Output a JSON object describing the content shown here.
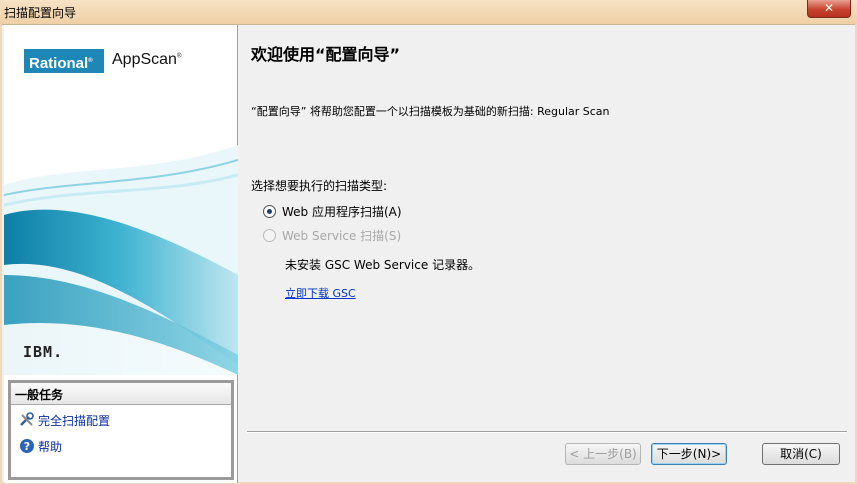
{
  "window": {
    "title": "扫描配置向导",
    "close_glyph": "✕"
  },
  "sidebar": {
    "logo_text": "Rational",
    "logo_mark": "®",
    "product": "AppScan",
    "product_mark": "®",
    "vendor": "IBM.",
    "tasks": {
      "header": "一般任务",
      "items": [
        {
          "label": "完全扫描配置",
          "icon": "tools-icon"
        },
        {
          "label": "帮助",
          "icon": "help-icon"
        }
      ]
    }
  },
  "main": {
    "heading": "欢迎使用“配置向导”",
    "description": "“配置向导” 将帮助您配置一个以扫描模板为基础的新扫描: Regular Scan",
    "prompt": "选择想要执行的扫描类型:",
    "options": [
      {
        "label": "Web 应用程序扫描(A)",
        "checked": true,
        "enabled": true
      },
      {
        "label": "Web Service 扫描(S)",
        "checked": false,
        "enabled": false
      }
    ],
    "note": "未安装 GSC Web Service 记录器。",
    "link": "立即下载 GSC"
  },
  "buttons": {
    "back": "< 上一步(B)",
    "next": "下一步(N)>",
    "cancel": "取消(C)"
  },
  "colors": {
    "brand_blue": "#1d88b8",
    "link": "#0033cc",
    "title_bar": "#efd0a6"
  }
}
